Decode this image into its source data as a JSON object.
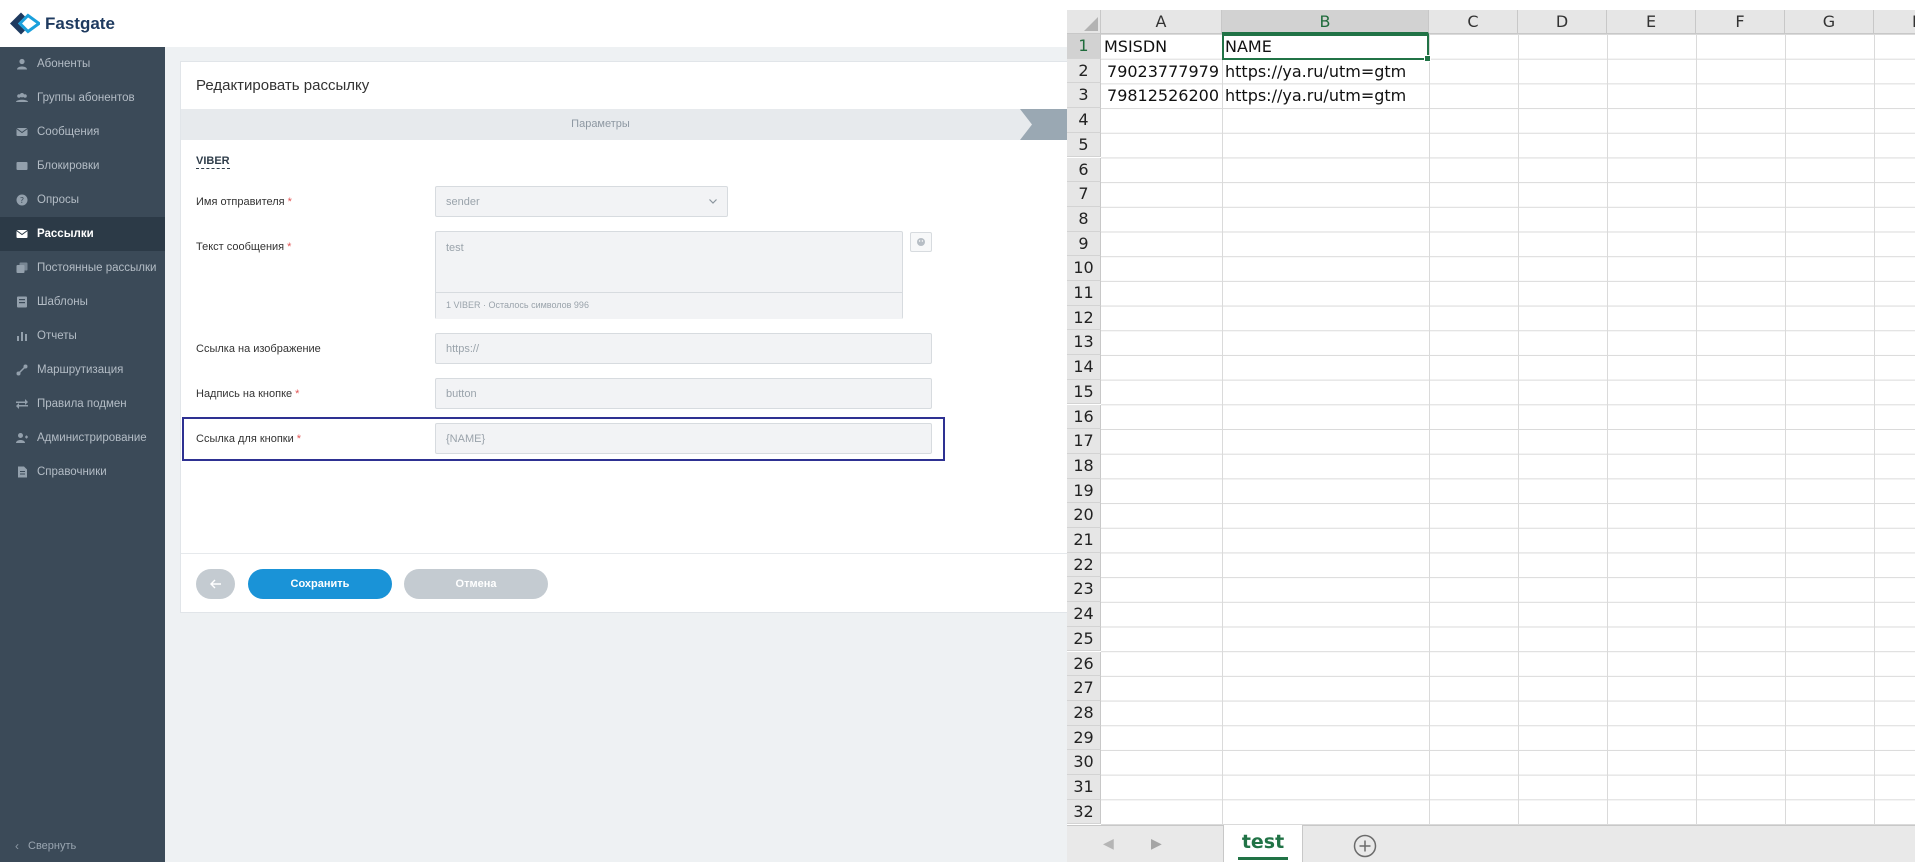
{
  "app": {
    "brand": "Fastgate",
    "sidebar": {
      "items": [
        {
          "label": "Абоненты",
          "icon": "user-icon",
          "active": false
        },
        {
          "label": "Группы абонентов",
          "icon": "users-icon",
          "active": false
        },
        {
          "label": "Сообщения",
          "icon": "mail-icon",
          "active": false
        },
        {
          "label": "Блокировки",
          "icon": "block-icon",
          "active": false
        },
        {
          "label": "Опросы",
          "icon": "question-icon",
          "active": false
        },
        {
          "label": "Рассылки",
          "icon": "mail-icon",
          "active": true
        },
        {
          "label": "Постоянные рассылки",
          "icon": "recurring-icon",
          "active": false
        },
        {
          "label": "Шаблоны",
          "icon": "template-icon",
          "active": false
        },
        {
          "label": "Отчеты",
          "icon": "chart-icon",
          "active": false
        },
        {
          "label": "Маршрутизация",
          "icon": "route-icon",
          "active": false
        },
        {
          "label": "Правила подмен",
          "icon": "swap-icon",
          "active": false
        },
        {
          "label": "Администрирование",
          "icon": "admin-icon",
          "active": false
        },
        {
          "label": "Справочники",
          "icon": "book-icon",
          "active": false
        }
      ],
      "collapse_label": "Свернуть"
    },
    "form": {
      "title": "Редактировать рассылку",
      "step_label": "Параметры",
      "channel": "VIBER",
      "sender_label": "Имя отправителя",
      "sender_value": "sender",
      "message_label": "Текст сообщения",
      "message_value": "test",
      "message_counter": "1 VIBER  ·  Осталось символов 996",
      "image_label": "Ссылка на изображение",
      "image_placeholder": "https://",
      "button_text_label": "Надпись на кнопке",
      "button_text_value": "button",
      "button_link_label": "Ссылка для кнопки",
      "button_link_value": "{NAME}",
      "required_mark": "*",
      "save_label": "Сохранить",
      "cancel_label": "Отмена"
    },
    "colors": {
      "sidebar_bg": "#3b4a58",
      "sidebar_active_bg": "#2c3a47",
      "primary": "#1a93d7",
      "highlight": "#2e3192"
    }
  },
  "sheet": {
    "columns": [
      "A",
      "B",
      "C",
      "D",
      "E",
      "F",
      "G",
      "H"
    ],
    "selected_column": "B",
    "rows": [
      "1",
      "2",
      "3",
      "4",
      "5",
      "6",
      "7",
      "8",
      "9",
      "10",
      "11",
      "12",
      "13",
      "14",
      "15",
      "16",
      "17",
      "18",
      "19",
      "20",
      "21",
      "22",
      "23",
      "24",
      "25",
      "26",
      "27",
      "28",
      "29",
      "30",
      "31",
      "32"
    ],
    "selected_row": "1",
    "cells": [
      {
        "a": "MSISDN",
        "b": "NAME"
      },
      {
        "a": "79023777979",
        "b": "https://ya.ru/utm=gtm"
      },
      {
        "a": "79812526200",
        "b": "https://ya.ru/utm=gtm"
      }
    ],
    "tab_name": "test",
    "accent": "#217346"
  }
}
